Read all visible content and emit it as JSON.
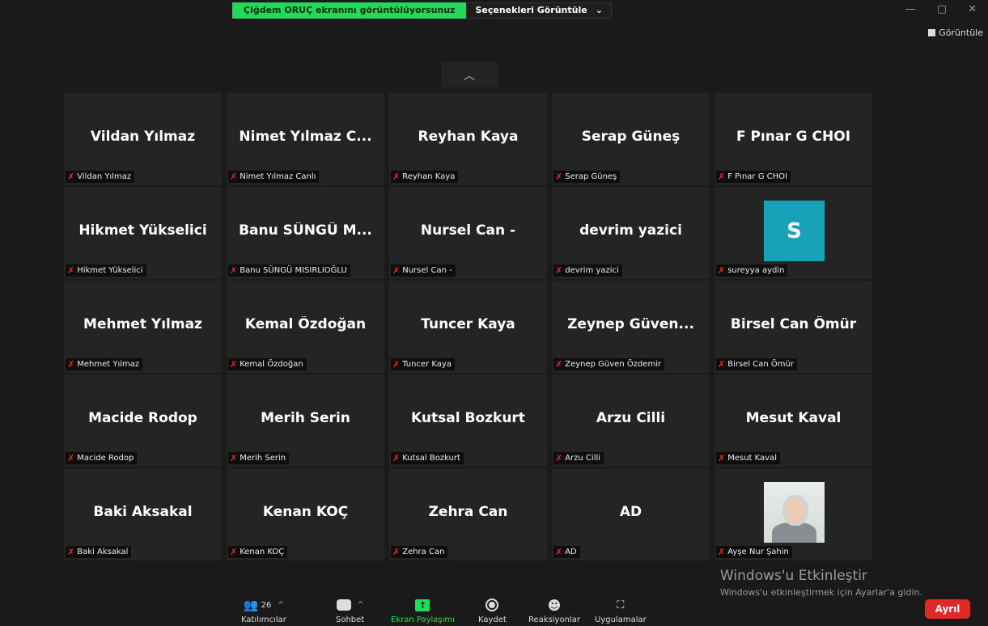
{
  "banner": {
    "sharing_text": "Çiğdem ORUÇ ekranını görüntülüyorsunuz",
    "options_label": "Seçenekleri Görüntüle"
  },
  "view_label": "Görüntüle",
  "participants": [
    {
      "big": "Vildan Yılmaz",
      "name": "Vildan Yılmaz"
    },
    {
      "big": "Nimet Yılmaz C...",
      "name": "Nimet Yılmaz Canlı"
    },
    {
      "big": "Reyhan Kaya",
      "name": "Reyhan Kaya"
    },
    {
      "big": "Serap Güneş",
      "name": "Serap Güneş"
    },
    {
      "big": "F Pınar G CHOI",
      "name": "F Pınar G CHOI"
    },
    {
      "big": "Hikmet Yükselici",
      "name": "Hikmet Yükselici"
    },
    {
      "big": "Banu SÜNGÜ M...",
      "name": "Banu SÜNGÜ MISIRLIOĞLU"
    },
    {
      "big": "Nursel Can -",
      "name": "Nursel Can -"
    },
    {
      "big": "devrim yazici",
      "name": "devrim yazici"
    },
    {
      "big": "",
      "avatar_letter": "S",
      "name": "sureyya aydin"
    },
    {
      "big": "Mehmet Yılmaz",
      "name": "Mehmet Yılmaz"
    },
    {
      "big": "Kemal Özdoğan",
      "name": "Kemal Özdoğan"
    },
    {
      "big": "Tuncer Kaya",
      "name": "Tuncer Kaya"
    },
    {
      "big": "Zeynep Güven...",
      "name": "Zeynep Güven Özdemir"
    },
    {
      "big": "Birsel Can Ömür",
      "name": "Birsel Can Ömür"
    },
    {
      "big": "Macide Rodop",
      "name": "Macide Rodop"
    },
    {
      "big": "Merih Serin",
      "name": "Merih Serin"
    },
    {
      "big": "Kutsal Bozkurt",
      "name": "Kutsal Bozkurt"
    },
    {
      "big": "Arzu Cilli",
      "name": "Arzu Cilli"
    },
    {
      "big": "Mesut Kaval",
      "name": "Mesut Kaval"
    },
    {
      "big": "Baki Aksakal",
      "name": "Baki Aksakal"
    },
    {
      "big": "Kenan KOÇ",
      "name": "Kenan KOÇ"
    },
    {
      "big": "Zehra Can",
      "name": "Zehra Can"
    },
    {
      "big": "AD",
      "name": "AD"
    },
    {
      "big": "",
      "photo": true,
      "name": "Ayşe Nur Şahin"
    }
  ],
  "watermark": {
    "title": "Windows'u Etkinleştir",
    "subtitle": "Windows'u etkinleştirmek için Ayarlar'a gidin."
  },
  "toolbar": {
    "participants_label": "Katılımcılar",
    "participants_count": "26",
    "chat_label": "Sohbet",
    "share_label": "Ekran Paylaşımı",
    "record_label": "Kaydet",
    "reactions_label": "Reaksiyonlar",
    "apps_label": "Uygulamalar",
    "leave_label": "Ayrıl"
  },
  "colors": {
    "accent_green": "#23d959",
    "leave_red": "#e02828",
    "avatar_teal": "#17a2b8",
    "mic_off_red": "#e02828"
  }
}
